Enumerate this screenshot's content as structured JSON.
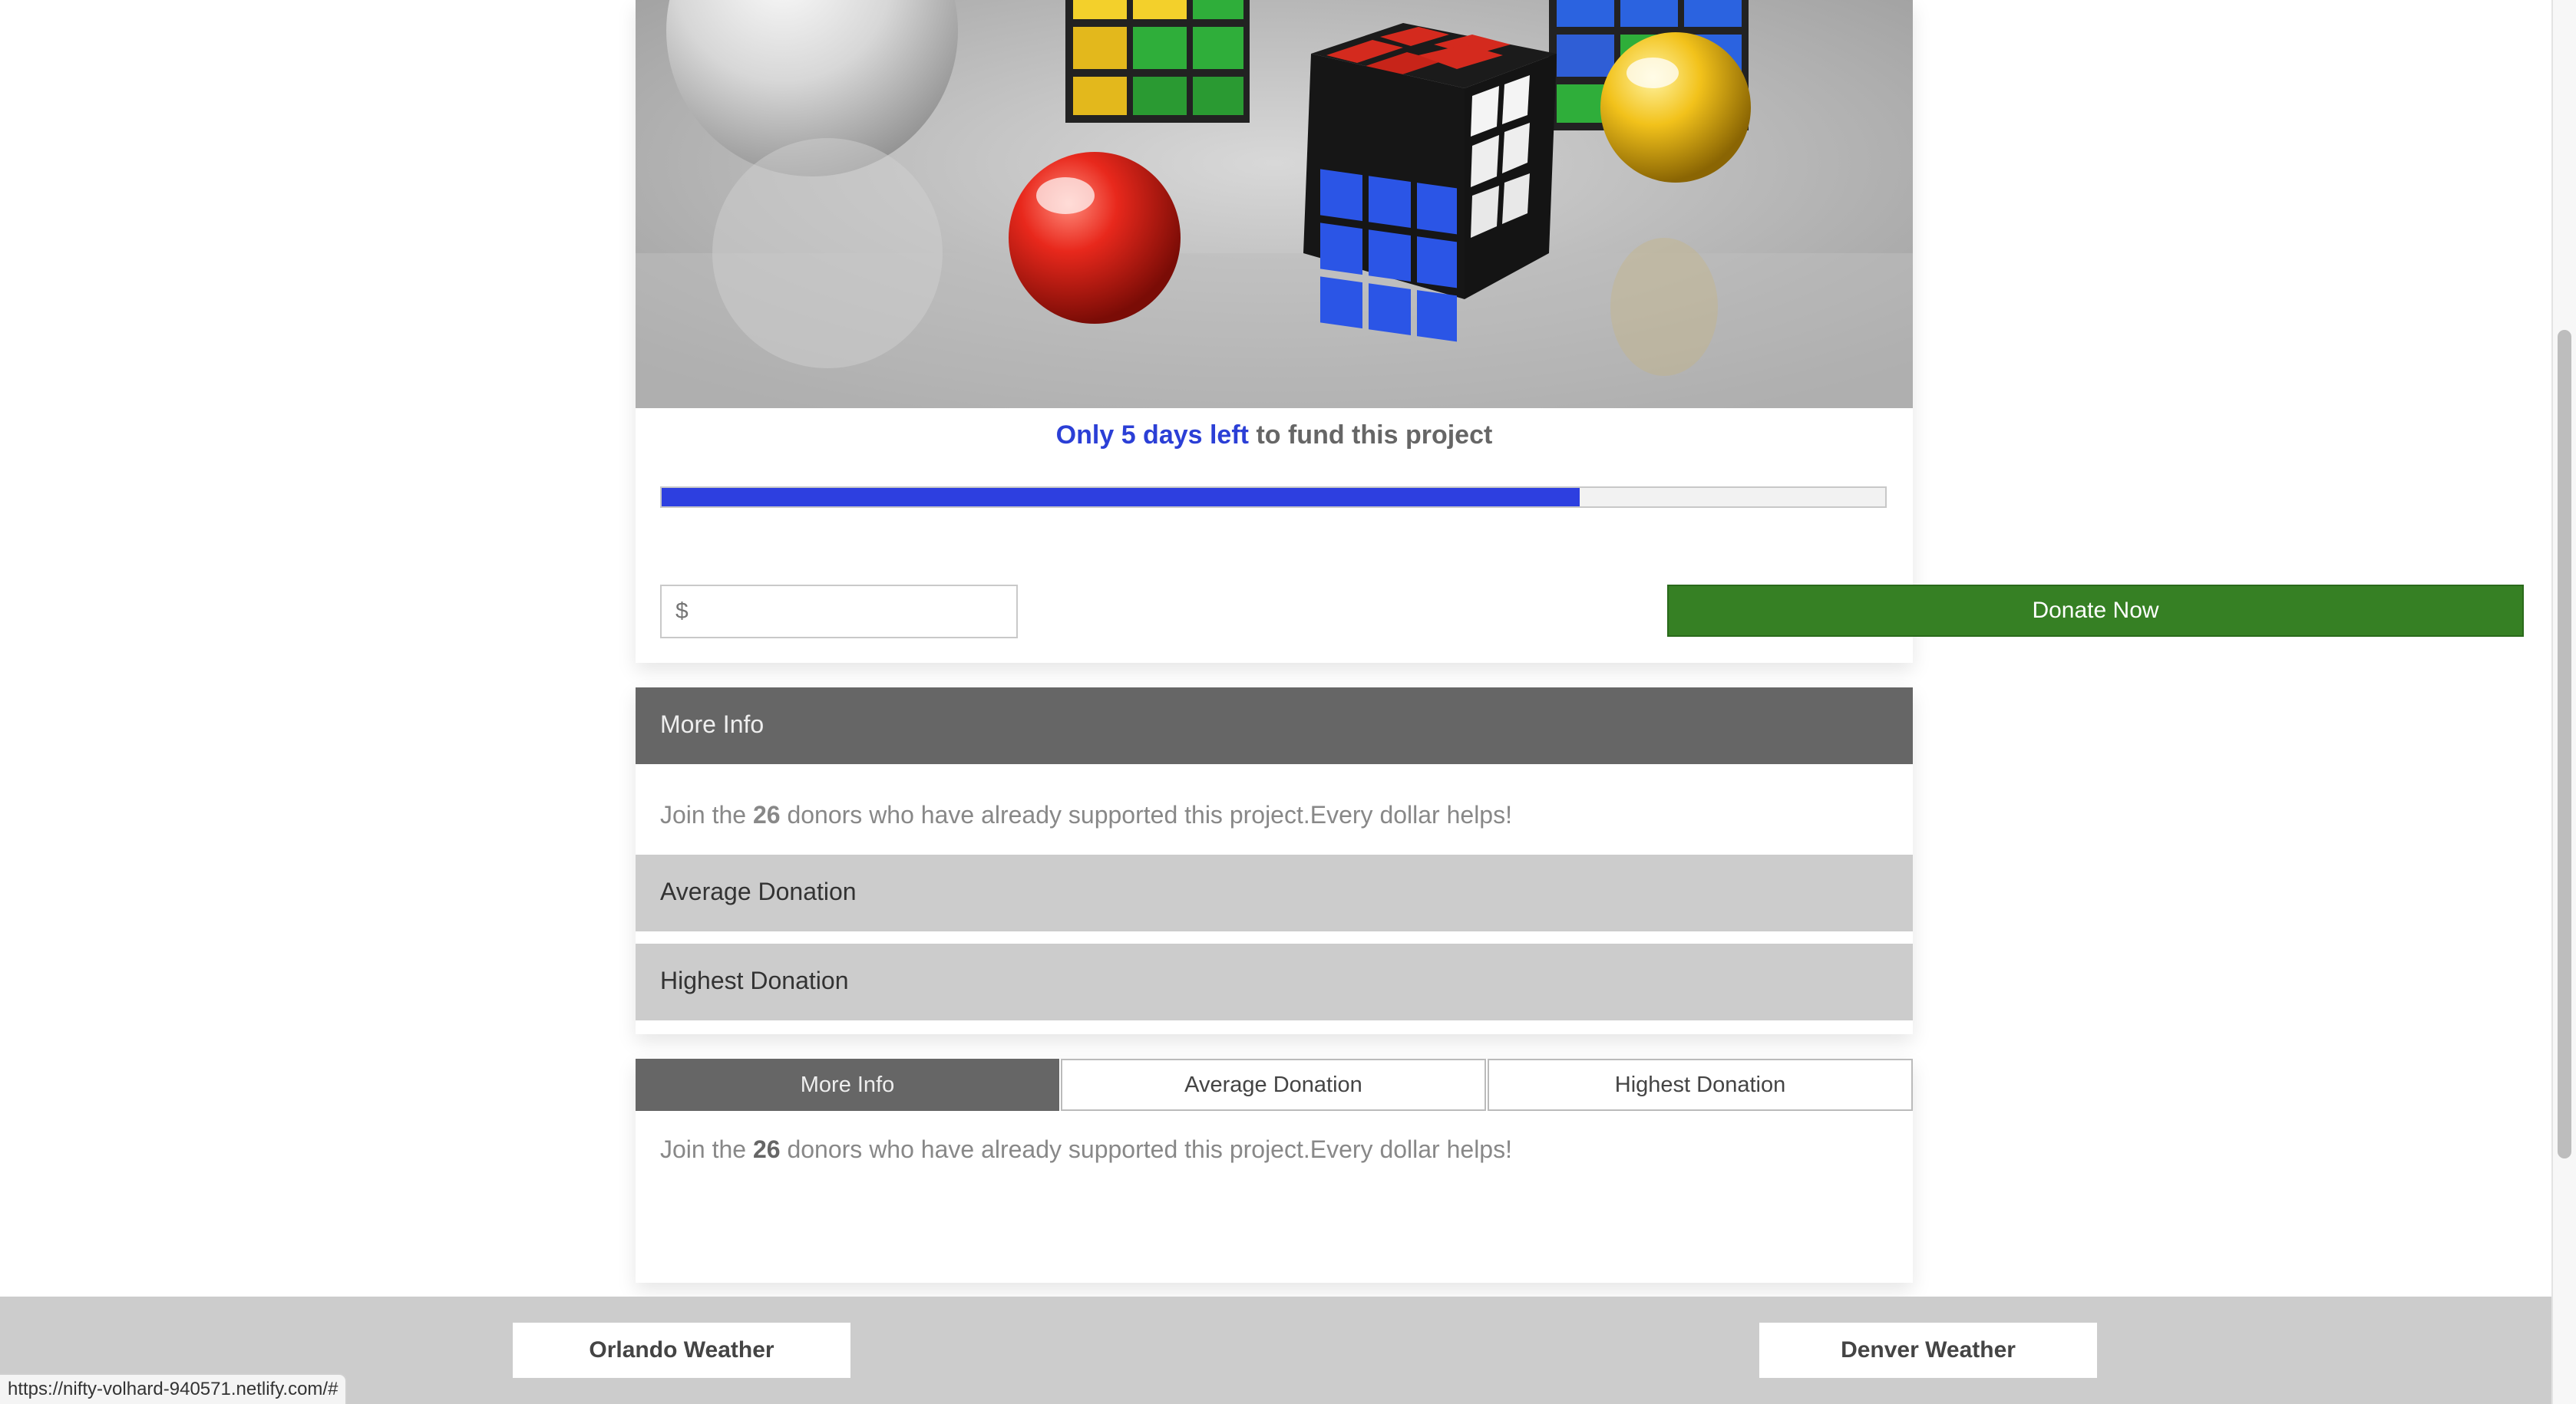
{
  "campaign": {
    "deadline_accent": "Only 5 days left",
    "deadline_rest": " to fund this project",
    "progress_fraction": 0.75,
    "amount_placeholder": "$",
    "donate_label": "Donate Now"
  },
  "accordion": {
    "header": "More Info",
    "text_prefix": "Join the ",
    "donor_count": "26",
    "text_suffix": " donors who have already supported this project.Every dollar helps!",
    "rows": [
      "Average Donation",
      "Highest Donation"
    ]
  },
  "tabs": {
    "items": [
      "More Info",
      "Average Donation",
      "Highest Donation"
    ],
    "active_index": 0,
    "text_prefix": "Join the ",
    "donor_count": "26",
    "text_suffix": " donors who have already supported this project.Every dollar helps!"
  },
  "footer": {
    "left_button": "Orlando Weather",
    "right_button": "Denver Weather"
  },
  "status_bar": {
    "url": "https://nifty-volhard-940571.netlify.com/#"
  },
  "colors": {
    "accent": "#2b3fd6",
    "progress": "#2d3fe0",
    "donate": "#368024",
    "header_gray": "#666666",
    "row_gray": "#cccccc"
  }
}
